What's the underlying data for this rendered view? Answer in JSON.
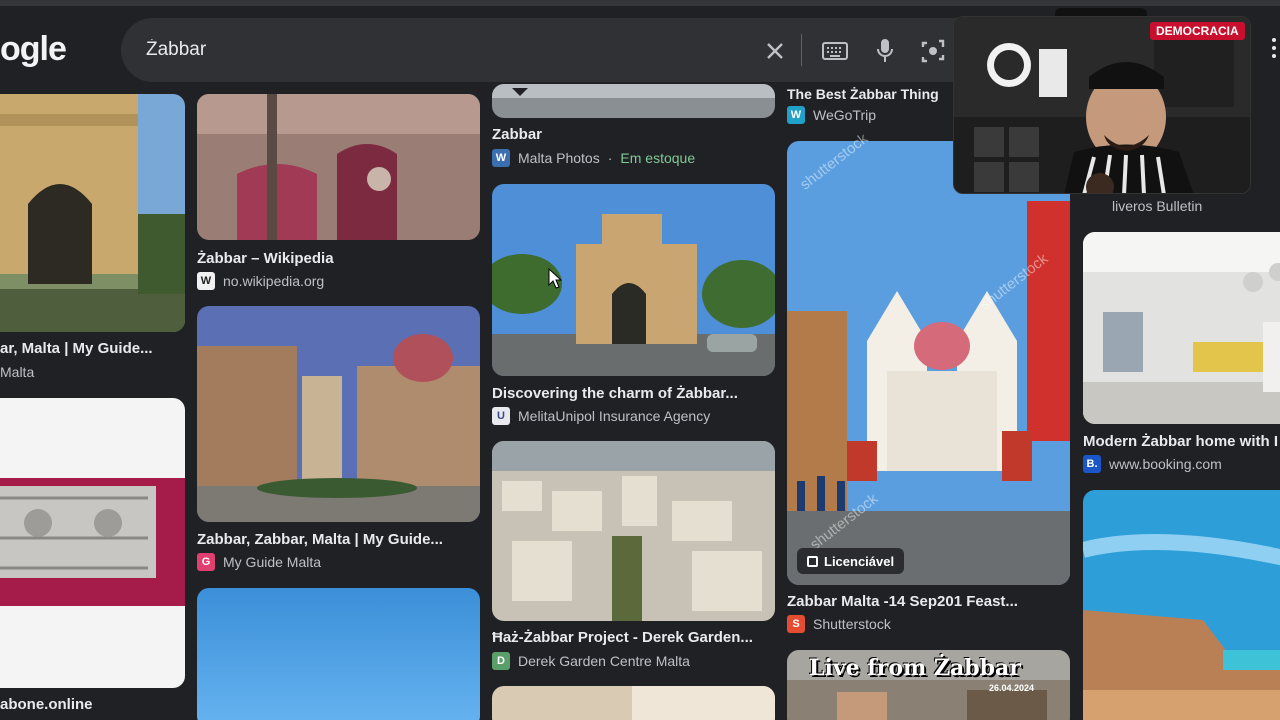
{
  "header": {
    "logo_text": "ogle",
    "search_value": "Żabbar"
  },
  "cards": [
    {
      "id": "c1",
      "caption": "ar, Malta | My Guide...",
      "source": "Malta"
    },
    {
      "id": "c2",
      "caption": "Żabbar – Wikipedia",
      "source": "no.wikipedia.org",
      "favicon": "W"
    },
    {
      "id": "c3",
      "caption": "Zabbar",
      "source": "Malta Photos",
      "stock": "Em estoque",
      "favicon": "W"
    },
    {
      "id": "c4",
      "caption": "The Best Żabbar Thing",
      "source": "WeGoTrip",
      "favicon": "W"
    },
    {
      "id": "c5",
      "caption": "Discovering the charm of Żabbar...",
      "source": "MelitaUnipol Insurance Agency",
      "favicon": "U"
    },
    {
      "id": "c6",
      "caption": "Zabbar, Zabbar, Malta | My Guide...",
      "source": "My Guide Malta",
      "favicon": "G"
    },
    {
      "id": "c7",
      "caption": "Zabbar Malta -14 Sep201 Feast...",
      "source": "Shutterstock",
      "favicon": "S",
      "badge": "Licenciável"
    },
    {
      "id": "c8",
      "caption": "Ħaż-Żabbar Project - Derek Garden...",
      "source": "Derek Garden Centre Malta",
      "favicon": "D"
    },
    {
      "id": "c9",
      "caption": "Modern Żabbar home with I",
      "source": "www.booking.com",
      "favicon": "B."
    },
    {
      "id": "c10",
      "source": "liveros Bulletin"
    },
    {
      "id": "c11",
      "source": "abone.online"
    }
  ],
  "overlay": {
    "live_text": "Live from Żabbar",
    "live_date": "26.04.2024",
    "watermark": "shutterstock",
    "webcam_label": "DEMOCRACIA"
  },
  "colors": {
    "background": "#202124",
    "search_bar": "#303134",
    "text_primary": "#e8eaed",
    "text_secondary": "#bdc1c6",
    "in_stock": "#81c995"
  },
  "icons": [
    "clear-icon",
    "keyboard-icon",
    "microphone-icon",
    "lens-camera-icon",
    "apps-icon"
  ]
}
